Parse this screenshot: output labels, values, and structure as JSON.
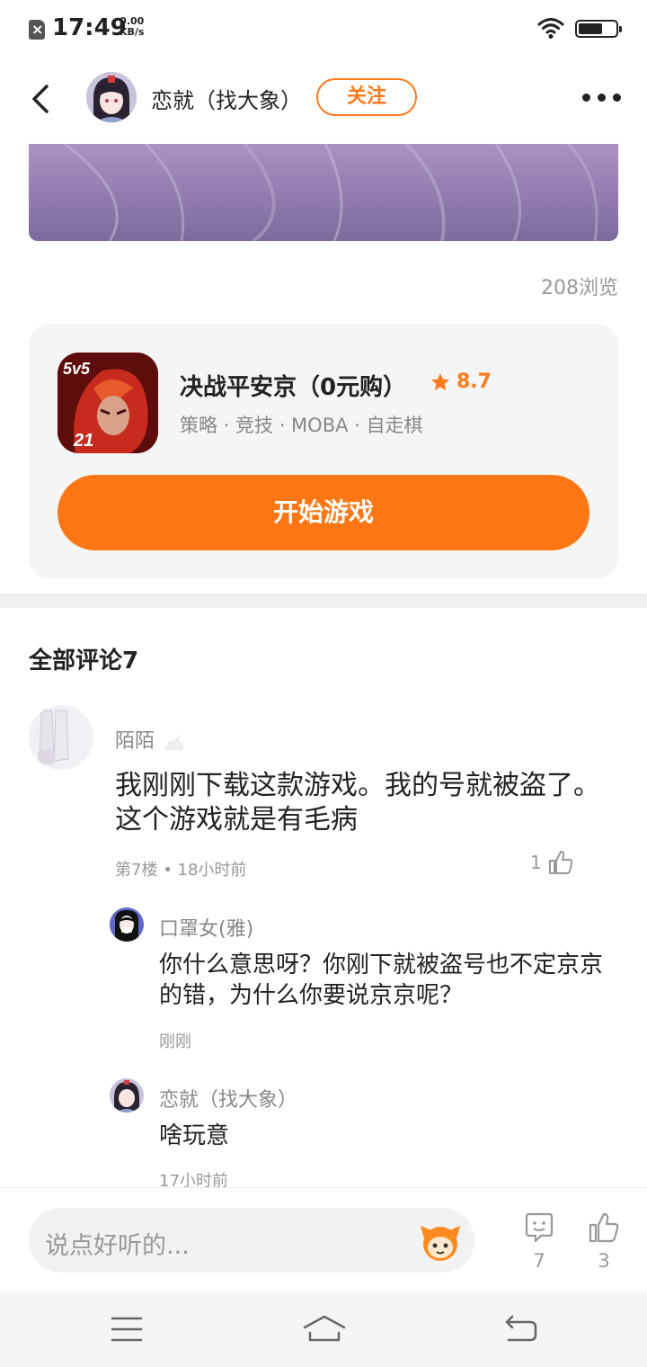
{
  "status_bar": {
    "time": "17:49",
    "net_speed_value": "0.00",
    "net_speed_unit": "KB/s"
  },
  "header": {
    "author_name": "恋就（找大象）",
    "follow_label": "关注"
  },
  "post": {
    "view_count": "208浏览"
  },
  "game_card": {
    "title": "决战平安京（0元购）",
    "rating": "8.7",
    "tags": "策略 · 竞技 · MOBA · 自走棋",
    "play_label": "开始游戏",
    "accent_color": "#ff7714"
  },
  "comments": {
    "heading": "全部评论7",
    "items": [
      {
        "author": "陌陌",
        "text": "我刚刚下载这款游戏。我的号就被盗了。这个游戏就是有毛病",
        "floor": "第7楼",
        "time": "18小时前",
        "likes": "1",
        "replies": [
          {
            "author": "口罩女(雅)",
            "text": "你什么意思呀？你刚下就被盗号也不定京京的错，为什么你要说京京呢？",
            "time": "刚刚"
          },
          {
            "author": "恋就（找大象）",
            "text": "啥玩意",
            "time": "17小时前"
          }
        ]
      }
    ]
  },
  "input_bar": {
    "placeholder": "说点好听的...",
    "comment_count": "7",
    "like_count": "3"
  },
  "icons": {
    "back": "back-chevron-icon",
    "more": "more-dots-icon",
    "star": "star-icon",
    "thumb": "thumb-up-icon",
    "comment": "comment-bubble-icon",
    "nav_menu": "menu-icon",
    "nav_home": "home-icon",
    "nav_back": "return-icon"
  }
}
